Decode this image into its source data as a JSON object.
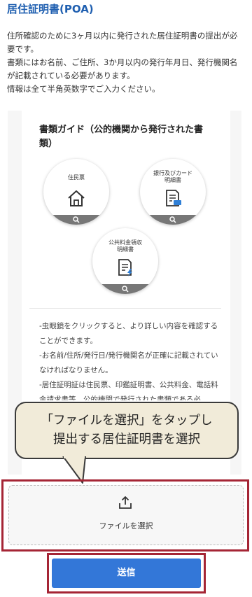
{
  "header": {
    "title": "居住証明書(POA)"
  },
  "intro": {
    "lines": [
      "住所確認のために3ヶ月以内に発行された居住証明書の提出が必要です。",
      "書類にはお名前、ご住所、3か月以内の発行年月日、発行機関名が記載されている必要があります。",
      "情報は全て半角英数字でご入力ください。"
    ]
  },
  "guide": {
    "title": "書類ガイド（公的機関から発行された書類）",
    "documents": [
      {
        "label": "住民票",
        "icon": "house-icon"
      },
      {
        "label": "銀行及びカード\n明細書",
        "icon": "card-statement-icon"
      },
      {
        "label": "公共料金領収\n明細書",
        "icon": "utility-bill-icon"
      }
    ],
    "notes": [
      "-虫眼鏡をクリックすると、より詳しい内容を確認することができます。",
      "-お名前/住所/発行日/発行機関名が正確に記載されていなければなりません。",
      "-居住証明証は住民票、印鑑証明書、公共料金、電話料金請求書等、公的機関で発行された書類である必"
    ]
  },
  "callout": {
    "line1": "「ファイルを選択」をタップし",
    "line2": "提出する居住証明書を選択"
  },
  "upload": {
    "label": "ファイルを選択",
    "icon": "upload-icon"
  },
  "submit": {
    "label": "送信"
  },
  "colors": {
    "accent": "#3377d8",
    "highlight": "#a52535",
    "title": "#1f5fb0",
    "callout_bg": "#f1ebd9"
  }
}
